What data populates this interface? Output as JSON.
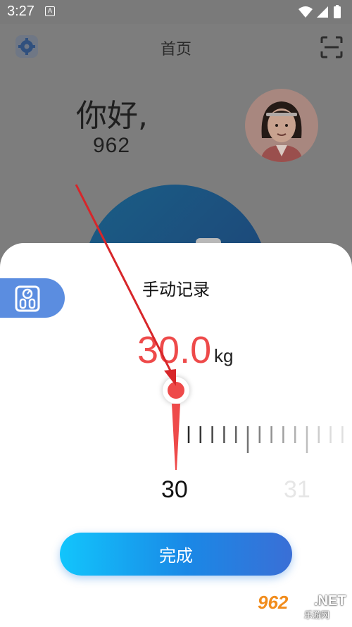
{
  "status_bar": {
    "time": "3:27",
    "app_icon_letter": "A",
    "icons": [
      "wifi-icon",
      "signal-icon",
      "battery-icon"
    ]
  },
  "home": {
    "title": "首页",
    "greeting": "你好,",
    "username": "962",
    "icons": {
      "settings": "gear-icon",
      "scan": "scan-icon",
      "avatar": "avatar"
    }
  },
  "sheet": {
    "title": "手动记录",
    "weight_value": "30.0",
    "unit": "kg",
    "ruler": {
      "current_label": "30",
      "next_label": "31",
      "current_value": 30.0
    },
    "done_label": "完成",
    "tab_icon": "scale-icon"
  },
  "watermark": {
    "logo": "962",
    "suffix": ".NET",
    "subtitle": "乐游网"
  },
  "colors": {
    "accent_red": "#ee4a4a",
    "button_gradient_start": "#12c5fc",
    "button_gradient_end": "#3a6fd6",
    "tab_blue": "#5b8de0",
    "dim_overlay": "#7d7d7d"
  }
}
